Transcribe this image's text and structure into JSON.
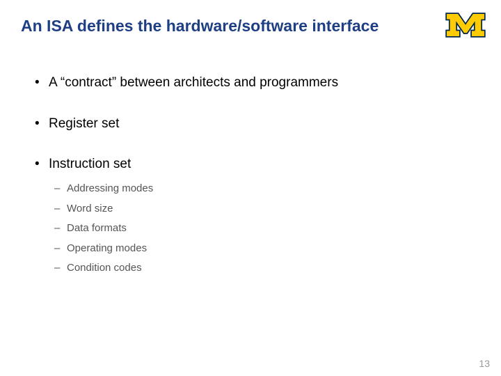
{
  "title": "An ISA defines the hardware/software interface",
  "logo": {
    "name": "university-of-michigan-block-m"
  },
  "bullets": [
    {
      "text": "A “contract” between architects and programmers"
    },
    {
      "text": "Register set"
    },
    {
      "text": "Instruction set",
      "sub": [
        "Addressing modes",
        "Word size",
        "Data formats",
        "Operating modes",
        "Condition codes"
      ]
    }
  ],
  "page_number": "13"
}
